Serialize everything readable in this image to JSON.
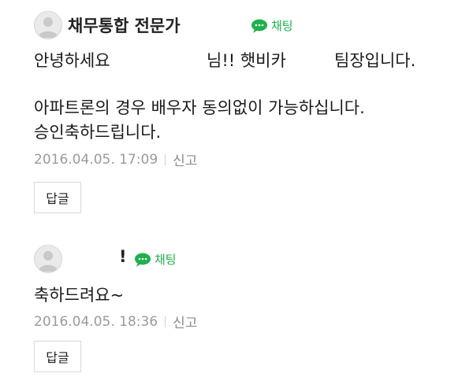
{
  "comments": [
    {
      "author": "채무통합 전문가",
      "chat_label": "채팅",
      "lines": [
        {
          "part1": "안녕하세요",
          "part2": "님!! 햇비카",
          "part3": "팀장입니다."
        },
        "아파트론의 경우 배우자 동의없이 가능하십니다.",
        "승인축하드립니다."
      ],
      "date": "2016.04.05. 17:09",
      "report_label": "신고",
      "reply_label": "답글"
    },
    {
      "author": "!",
      "chat_label": "채팅",
      "lines": [
        "축하드려요~"
      ],
      "date": "2016.04.05. 18:36",
      "report_label": "신고",
      "reply_label": "답글"
    }
  ],
  "colors": {
    "chat_green": "#1db14b",
    "meta_gray": "#9a9a9a"
  },
  "icons": {
    "avatar": "default-profile-icon",
    "chat": "speech-bubble-icon"
  }
}
